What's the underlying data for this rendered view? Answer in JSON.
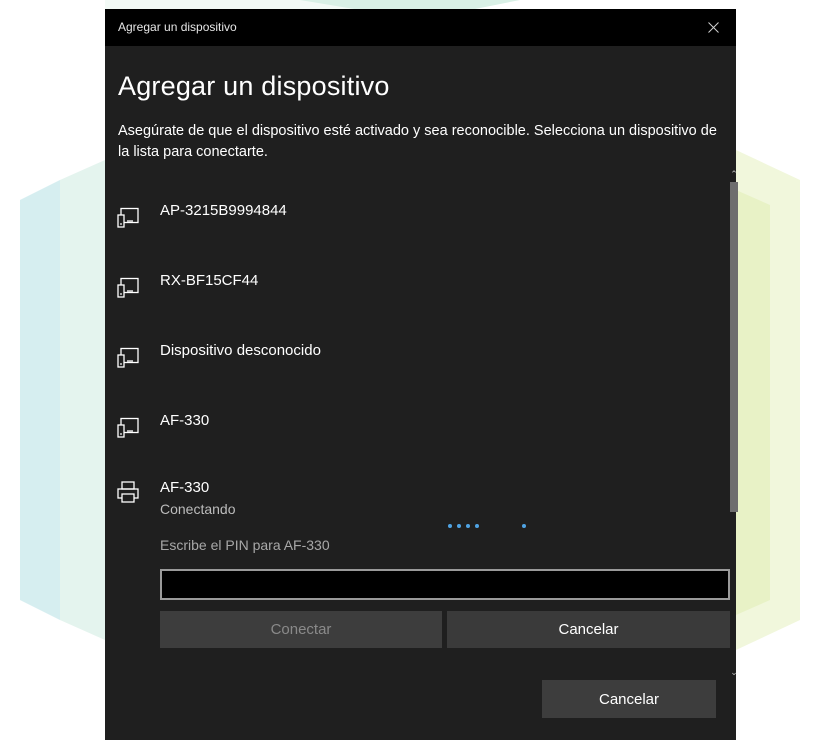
{
  "window": {
    "title": "Agregar un dispositivo",
    "close_icon": "close-icon"
  },
  "dialog": {
    "heading": "Agregar un dispositivo",
    "description": "Asegúrate de que el dispositivo esté activado y sea reconocible. Selecciona un dispositivo de la lista para conectarte."
  },
  "devices": [
    {
      "name": "AP-3215B9994844",
      "icon": "display-device-icon"
    },
    {
      "name": "RX-BF15CF44",
      "icon": "display-device-icon"
    },
    {
      "name": "Dispositivo desconocido",
      "icon": "display-device-icon"
    },
    {
      "name": "AF-330",
      "icon": "display-device-icon"
    },
    {
      "name": "AF-330",
      "icon": "printer-icon",
      "status": "Conectando",
      "pin_label": "Escribe el PIN para AF-330",
      "pin_value": "",
      "connect_label": "Conectar",
      "cancel_label": "Cancelar"
    }
  ],
  "footer": {
    "cancel_label": "Cancelar"
  },
  "colors": {
    "dialog_bg": "#1f1f1f",
    "titlebar_bg": "#000000",
    "accent": "#4fa3e3"
  }
}
